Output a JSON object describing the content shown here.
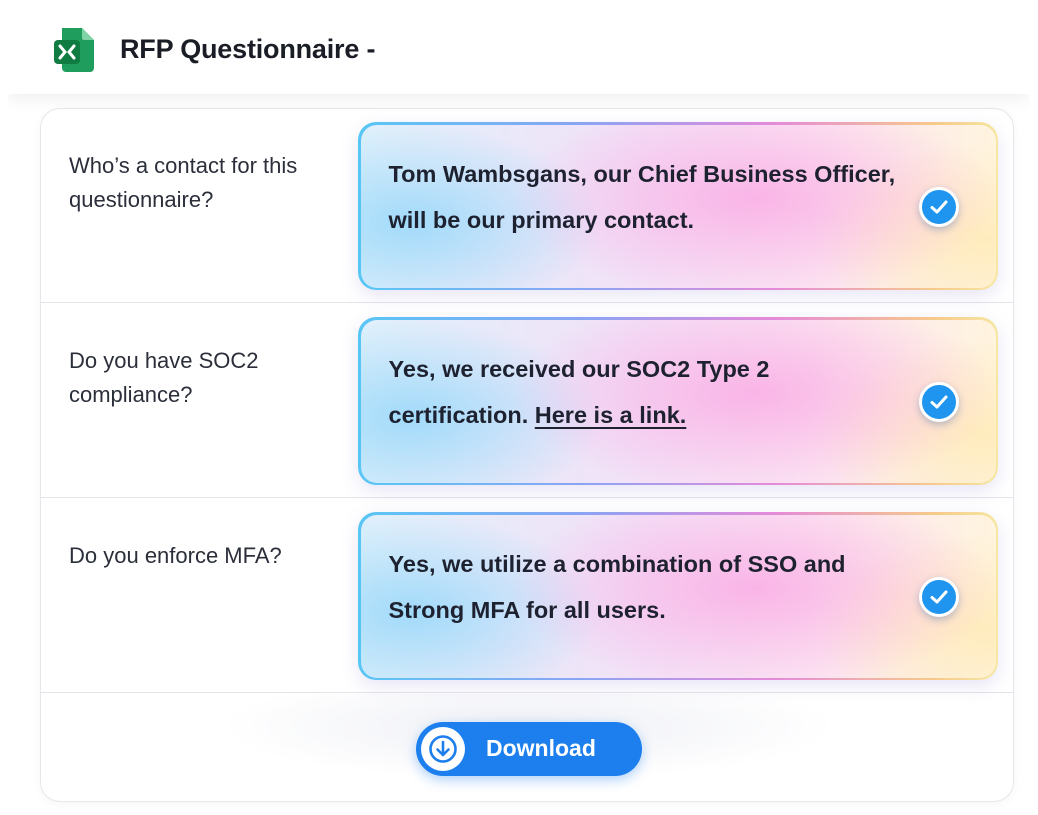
{
  "header": {
    "title": "RFP Questionnaire  -",
    "app_icon": "excel-file-icon",
    "icon_color": "#21a366"
  },
  "rows": [
    {
      "question": "Who’s a contact for this questionnaire?",
      "answer_text": "Tom Wambsgans, our Chief Business Officer, will be our primary contact.",
      "answer_link": "",
      "status_icon": "check-circle-icon"
    },
    {
      "question": "Do you have SOC2 compliance?",
      "answer_text": "Yes, we received our SOC2 Type 2 certification. ",
      "answer_link": "Here is a link.",
      "status_icon": "check-circle-icon"
    },
    {
      "question": "Do you enforce MFA?",
      "answer_text": "Yes, we utilize a combination of SSO and Strong MFA for all users.",
      "answer_link": "",
      "status_icon": "check-circle-icon"
    }
  ],
  "download": {
    "label": "Download",
    "icon": "download-arrow-icon",
    "color": "#1d7fee"
  },
  "colors": {
    "check": "#1f95ef",
    "border_gradient": [
      "#58c6f5",
      "#e58ad9",
      "#f6e7a3"
    ]
  }
}
